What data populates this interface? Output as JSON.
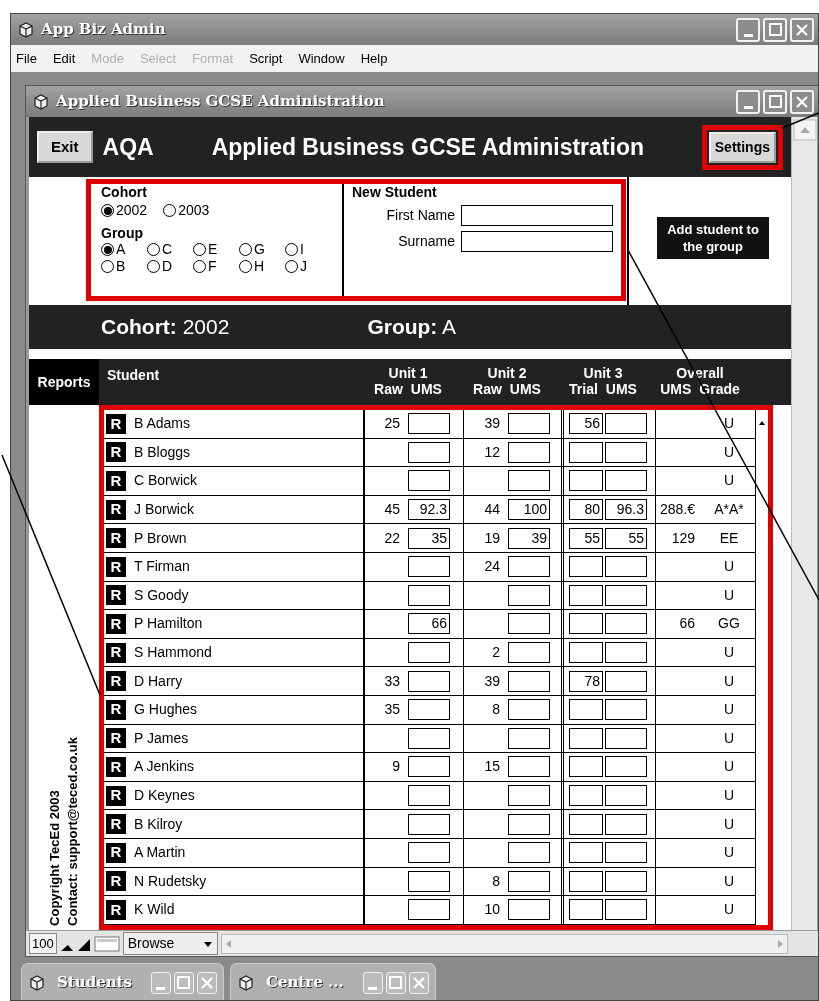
{
  "app_window": {
    "title": "App Biz Admin"
  },
  "menu": [
    {
      "label": "File",
      "disabled": false
    },
    {
      "label": "Edit",
      "disabled": false
    },
    {
      "label": "Mode",
      "disabled": true
    },
    {
      "label": "Select",
      "disabled": true
    },
    {
      "label": "Format",
      "disabled": true
    },
    {
      "label": "Script",
      "disabled": false
    },
    {
      "label": "Window",
      "disabled": false
    },
    {
      "label": "Help",
      "disabled": false
    }
  ],
  "document_window": {
    "title": "Applied Business GCSE Administration"
  },
  "header": {
    "exit_button": "Exit",
    "board": "AQA",
    "title": "Applied Business GCSE Administration",
    "settings_button": "Settings"
  },
  "cohort": {
    "label": "Cohort",
    "options": [
      {
        "label": "2002",
        "selected": true
      },
      {
        "label": "2003",
        "selected": false
      }
    ]
  },
  "group": {
    "label": "Group",
    "options": [
      {
        "label": "A",
        "selected": true
      },
      {
        "label": "C",
        "selected": false
      },
      {
        "label": "E",
        "selected": false
      },
      {
        "label": "G",
        "selected": false
      },
      {
        "label": "I",
        "selected": false
      },
      {
        "label": "B",
        "selected": false
      },
      {
        "label": "D",
        "selected": false
      },
      {
        "label": "F",
        "selected": false
      },
      {
        "label": "H",
        "selected": false
      },
      {
        "label": "J",
        "selected": false
      }
    ]
  },
  "new_student": {
    "title": "New Student",
    "fields": [
      {
        "label": "First Name"
      },
      {
        "label": "Surname"
      }
    ]
  },
  "tooltip": "Add student to the group",
  "summary": {
    "cohort_label": "Cohort:",
    "cohort_value": "2002",
    "group_label": "Group:",
    "group_value": "A"
  },
  "table": {
    "reports_label": "Reports",
    "student_label": "Student",
    "groups": [
      {
        "title": "Unit 1",
        "subs": [
          "Raw",
          "UMS"
        ]
      },
      {
        "title": "Unit 2",
        "subs": [
          "Raw",
          "UMS"
        ]
      },
      {
        "title": "Unit 3",
        "subs": [
          "Trial",
          "UMS"
        ]
      },
      {
        "title": "Overall",
        "subs": [
          "UMS",
          "Grade"
        ]
      }
    ],
    "rows": [
      {
        "report": "R",
        "name": "B Adams",
        "u1_raw": "25",
        "u2_raw": "39",
        "u3_trial": "56",
        "grade": "U"
      },
      {
        "report": "R",
        "name": "B Bloggs",
        "u2_raw": "12",
        "grade": "U"
      },
      {
        "report": "R",
        "name": "C Borwick",
        "grade": "U"
      },
      {
        "report": "R",
        "name": "J Borwick",
        "u1_raw": "45",
        "u1_ums": "92.3",
        "u2_raw": "44",
        "u2_ums": "100",
        "u3_trial": "80",
        "u3_ums": "96.3",
        "overall_ums": "288.€",
        "grade": "A*A*"
      },
      {
        "report": "R",
        "name": "P Brown",
        "u1_raw": "22",
        "u1_ums": "35",
        "u2_raw": "19",
        "u2_ums": "39",
        "u3_trial": "55",
        "u3_ums": "55",
        "overall_ums": "129",
        "grade": "EE"
      },
      {
        "report": "R",
        "name": "T Firman",
        "u2_raw": "24",
        "grade": "U"
      },
      {
        "report": "R",
        "name": "S Goody",
        "grade": "U"
      },
      {
        "report": "R",
        "name": "P Hamilton",
        "u1_ums": "66",
        "overall_ums": "66",
        "grade": "GG"
      },
      {
        "report": "R",
        "name": "S Hammond",
        "u2_raw": "2",
        "grade": "U"
      },
      {
        "report": "R",
        "name": "D Harry",
        "u1_raw": "33",
        "u2_raw": "39",
        "u3_trial": "78",
        "grade": "U"
      },
      {
        "report": "R",
        "name": "G Hughes",
        "u1_raw": "35",
        "u2_raw": "8",
        "grade": "U"
      },
      {
        "report": "R",
        "name": "P James",
        "grade": "U"
      },
      {
        "report": "R",
        "name": "A Jenkins",
        "u1_raw": "9",
        "u2_raw": "15",
        "grade": "U"
      },
      {
        "report": "R",
        "name": "D Keynes",
        "grade": "U"
      },
      {
        "report": "R",
        "name": "B Kilroy",
        "grade": "U"
      },
      {
        "report": "R",
        "name": "A Martin",
        "grade": "U"
      },
      {
        "report": "R",
        "name": "N Rudetsky",
        "u2_raw": "8",
        "grade": "U"
      },
      {
        "report": "R",
        "name": "K Wild",
        "u2_raw": "10",
        "grade": "U"
      }
    ]
  },
  "copyright": [
    "Copyright TecEd 2003",
    "Contact: support@teced.co.uk"
  ],
  "status_bar": {
    "zoom": "100",
    "mode": "Browse"
  },
  "taskbar": [
    {
      "title": "Students"
    },
    {
      "title": "Centre ..."
    }
  ]
}
